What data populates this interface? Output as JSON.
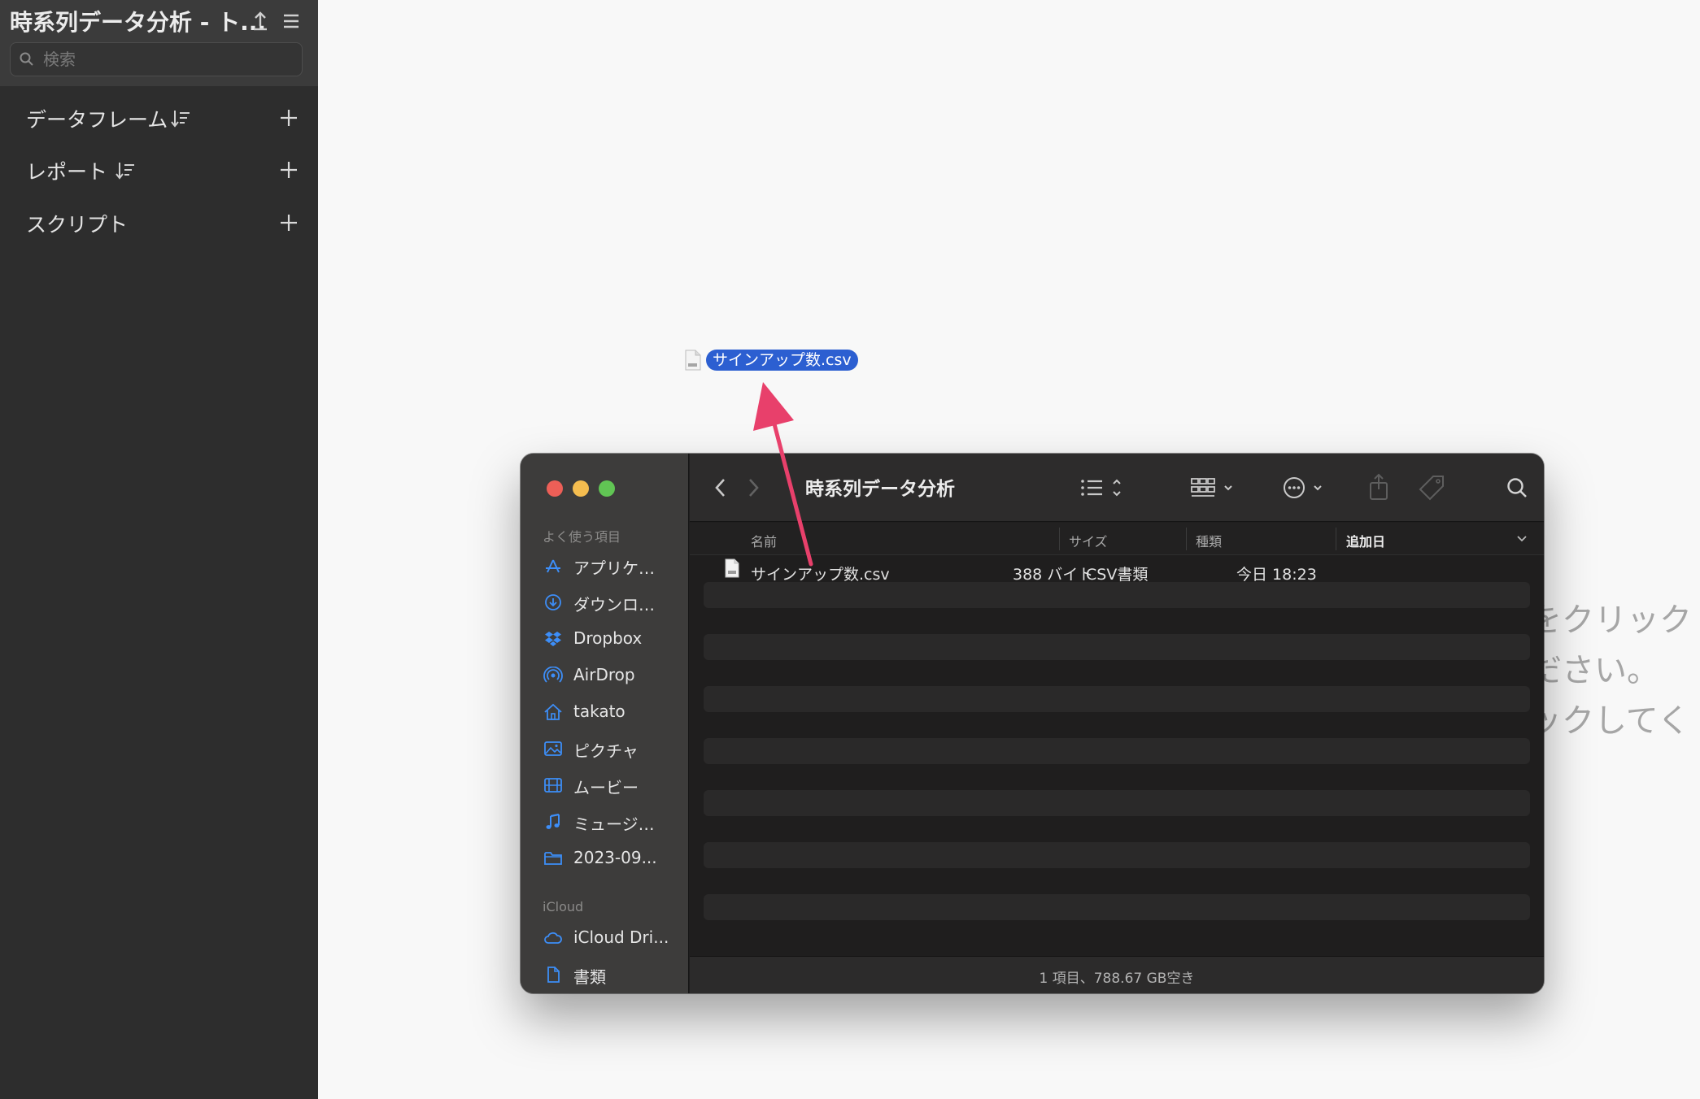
{
  "app": {
    "title": "時系列データ分析 - ト...",
    "search_placeholder": "検索",
    "sections": [
      {
        "label": "データフレーム"
      },
      {
        "label": "レポート"
      },
      {
        "label": "スクリプト"
      }
    ]
  },
  "drag": {
    "filename": "サインアップ数.csv"
  },
  "hint": {
    "lines": [
      "をクリック",
      "ださい。",
      "ックしてく"
    ]
  },
  "finder": {
    "title": "時系列データ分析",
    "sidebar": {
      "favorites_title": "よく使う項目",
      "favorites": [
        {
          "label": "アプリケ…",
          "icon": "applications-icon"
        },
        {
          "label": "ダウンロ…",
          "icon": "downloads-icon"
        },
        {
          "label": "Dropbox",
          "icon": "dropbox-icon"
        },
        {
          "label": "AirDrop",
          "icon": "airdrop-icon"
        },
        {
          "label": "takato",
          "icon": "home-icon"
        },
        {
          "label": "ピクチャ",
          "icon": "pictures-icon"
        },
        {
          "label": "ムービー",
          "icon": "movies-icon"
        },
        {
          "label": "ミュージ…",
          "icon": "music-icon"
        },
        {
          "label": "2023-09...",
          "icon": "folder-icon"
        }
      ],
      "icloud_title": "iCloud",
      "icloud": [
        {
          "label": "iCloud Dri...",
          "icon": "icloud-icon"
        },
        {
          "label": "書類",
          "icon": "document-icon"
        }
      ]
    },
    "columns": {
      "name": "名前",
      "size": "サイズ",
      "kind": "種類",
      "date_added": "追加日"
    },
    "files": [
      {
        "name": "サインアップ数.csv",
        "size": "388 バイト",
        "kind": "CSV書類",
        "date_added": "今日 18:23"
      }
    ],
    "status": "1 項目、788.67 GB空き"
  },
  "colors": {
    "accent": "#2c5fd1",
    "arrow": "#e8406b",
    "traffic_close": "#ed5f57",
    "traffic_min": "#f5bd4f",
    "traffic_max": "#61c554",
    "sidebar_icon_blue": "#3d8ef8"
  }
}
